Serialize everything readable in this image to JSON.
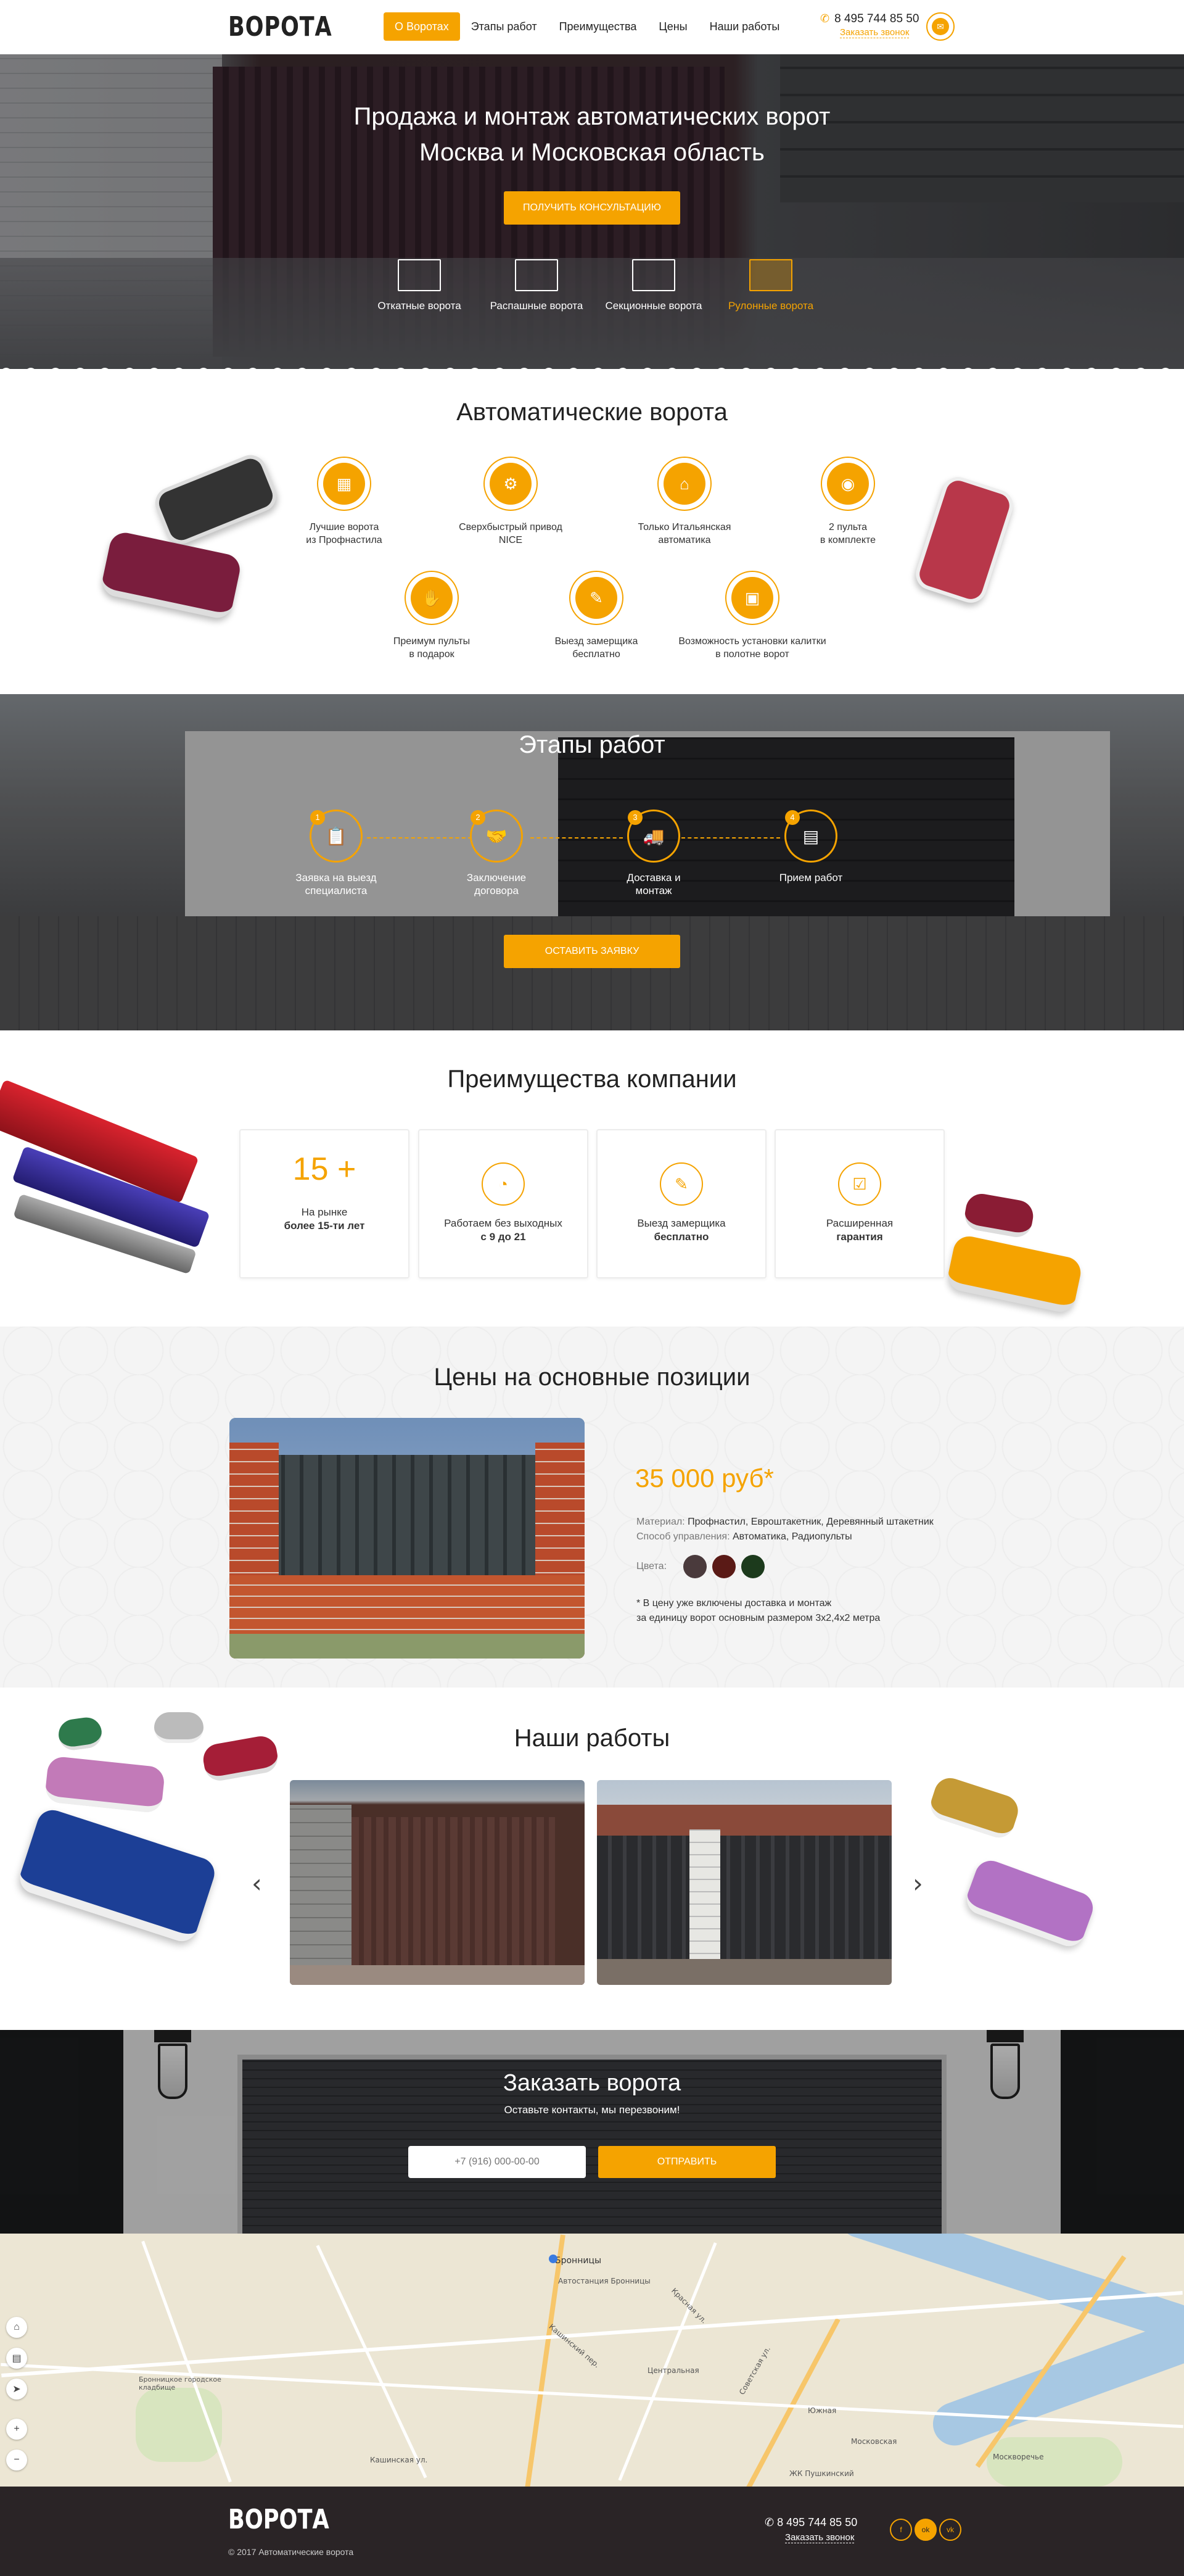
{
  "header": {
    "logo": "ВОРОТА",
    "nav": [
      "О Воротах",
      "Этапы работ",
      "Преимущества",
      "Цены",
      "Наши работы"
    ],
    "phone": "8 495 744 85 50",
    "callback": "Заказать звонок"
  },
  "hero": {
    "title_line1": "Продажа и монтаж автоматических ворот",
    "title_line2": "Москва и Московская область",
    "button": "ПОЛУЧИТЬ КОНСУЛЬТАЦИЮ",
    "types": [
      "Откатные ворота",
      "Распашные ворота",
      "Секционные ворота",
      "Рулонные ворота"
    ]
  },
  "automatic": {
    "title": "Автоматические ворота",
    "features": [
      {
        "line1": "Лучшие ворота",
        "line2": "из Профнастила"
      },
      {
        "line1": "Сверхбыстрый привод",
        "line2": "NICE"
      },
      {
        "line1": "Только Итальянская",
        "line2": "автоматика"
      },
      {
        "line1": "2 пульта",
        "line2": "в комплекте"
      },
      {
        "line1": "Преимум пульты",
        "line2": "в подарок"
      },
      {
        "line1": "Выезд замерщика",
        "line2": "бесплатно"
      },
      {
        "line1": "Возможность установки калитки",
        "line2": "в полотне ворот"
      }
    ]
  },
  "stages": {
    "title": "Этапы работ",
    "items": [
      {
        "num": "1",
        "line1": "Заявка на выезд",
        "line2": "специалиста"
      },
      {
        "num": "2",
        "line1": "Заключение",
        "line2": "договора"
      },
      {
        "num": "3",
        "line1": "Доставка и",
        "line2": "монтаж"
      },
      {
        "num": "4",
        "line1": "Прием работ",
        "line2": ""
      }
    ],
    "button": "ОСТАВИТЬ ЗАЯВКУ"
  },
  "advantages": {
    "title": "Преимущества компании",
    "cards": [
      {
        "big": "15 +",
        "line1": "На рынке",
        "line2": "более 15-ти лет"
      },
      {
        "line1": "Работаем без выходных",
        "line2": "с 9 до 21"
      },
      {
        "line1": "Выезд замерщика",
        "line2": "бесплатно"
      },
      {
        "line1": "Расширенная",
        "line2": "гарантия"
      }
    ]
  },
  "prices": {
    "title": "Цены на основные позиции",
    "price": "35 000 руб*",
    "material_label": "Материал:",
    "material": "Профнастил, Евроштакетник, Деревянный штакетник",
    "control_label": "Способ управления:",
    "control": "Автоматика, Радиопульты",
    "colors_label": "Цвета:",
    "colors": [
      "#4a3a3c",
      "#5a1a16",
      "#1c3a1c"
    ],
    "note1": "* В цену уже включены  доставка и монтаж",
    "note2": "за единицу ворот основным размером 3х2,4х2 метра"
  },
  "works": {
    "title": "Наши работы"
  },
  "order": {
    "title": "Заказать ворота",
    "subtitle": "Оставьте контакты, мы перезвоним!",
    "placeholder": "+7 (916) 000-00-00",
    "button": "ОТПРАВИТЬ"
  },
  "map": {
    "labels": [
      "Бронницы",
      "Автостанция Бронницы",
      "Советская ул.",
      "Москворечье",
      "Кашинский пер.",
      "Красная ул.",
      "Центральная",
      "Бронницкое городское кладбище",
      "Кашинская ул.",
      "ЖК Пушкинский",
      "Южная",
      "Московская"
    ]
  },
  "footer": {
    "logo": "ВОРОТА",
    "copyright": "© 2017 Автоматические ворота",
    "phone": "8 495 744 85 50",
    "callback": "Заказать звонок",
    "social": [
      "f",
      "ok",
      "vk"
    ]
  }
}
